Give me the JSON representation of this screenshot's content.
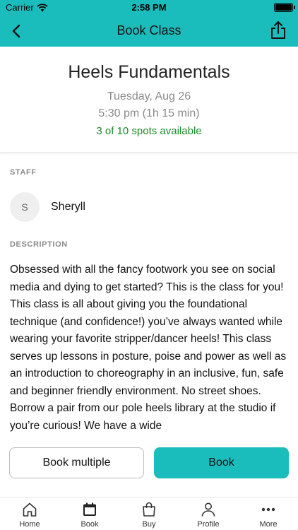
{
  "status_bar": {
    "carrier": "Carrier",
    "time": "2:58 PM"
  },
  "nav": {
    "title": "Book Class",
    "back_icon": "chevron-left-icon",
    "share_icon": "share-icon"
  },
  "class": {
    "title": "Heels Fundamentals",
    "date": "Tuesday, Aug 26",
    "time": "5:30 pm (1h 15 min)",
    "spots": "3 of 10 spots available",
    "spots_color": "#1d8a2b"
  },
  "staff": {
    "label": "STAFF",
    "initial": "S",
    "name": "Sheryll"
  },
  "description": {
    "label": "DESCRIPTION",
    "text": "Obsessed with all the fancy footwork you see on social media and dying to get started? This is the class for you! This class is all about giving you the foundational technique (and confidence!) you’ve always wanted while wearing your favorite stripper/dancer heels! This class serves up lessons in posture, poise and power as well as an introduction to choreography in an inclusive, fun, safe and beginner friendly environment. No street shoes. Borrow a pair from our pole heels library at the studio if you’re curious! We have a wide"
  },
  "actions": {
    "book_multiple": "Book multiple",
    "book": "Book"
  },
  "tabs": [
    {
      "label": "Home",
      "icon": "home-icon"
    },
    {
      "label": "Book",
      "icon": "calendar-icon"
    },
    {
      "label": "Buy",
      "icon": "shopping-bag-icon"
    },
    {
      "label": "Profile",
      "icon": "person-icon"
    },
    {
      "label": "More",
      "icon": "more-icon"
    }
  ],
  "colors": {
    "accent": "#1bbcbc"
  }
}
